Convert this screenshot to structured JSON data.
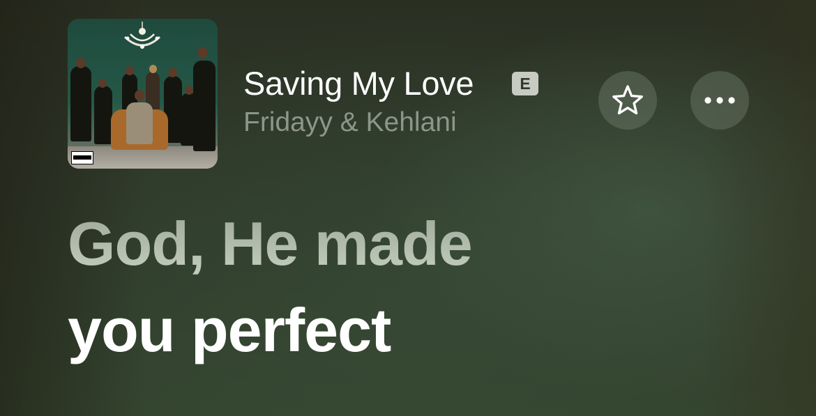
{
  "now_playing": {
    "title": "Saving My Love",
    "explicit_label": "E",
    "artist": "Fridayy & Kehlani",
    "album_art": "album-cover"
  },
  "actions": {
    "favorite_icon": "star-icon",
    "more_icon": "ellipsis-icon"
  },
  "lyrics": {
    "previous_line": "God, He made",
    "current_line": "you perfect"
  },
  "colors": {
    "background": "#2f3a2b",
    "title_text": "#ffffff",
    "artist_text": "#8c968a",
    "inactive_lyric": "#b6c0b0",
    "active_lyric": "#ffffff",
    "button_bg": "#5e6a5c"
  }
}
